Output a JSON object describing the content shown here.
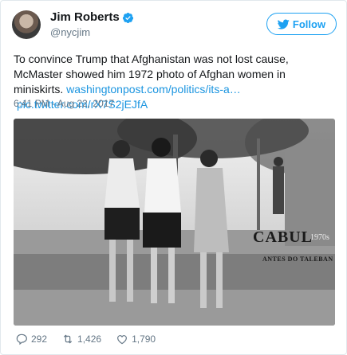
{
  "tweet": {
    "author_name": "Jim Roberts",
    "author_handle": "@nycjim",
    "follow_label": "Follow",
    "text": "To convince Trump that Afghanistan was not lost cause, McMaster showed him 1972 photo of Afghan women in miniskirts.",
    "link_1": "washingtonpost.com/politics/its-a…",
    "link_2": "pic.twitter.com/rX7S2jEJfA",
    "timestamp": "6:41 PM - Aug 22, 2017",
    "replies": "292",
    "retweets": "1,426",
    "likes": "1,790"
  },
  "photo": {
    "title": "CABUL",
    "decade": "1970s",
    "subtitle": "ANTES DO TALEBAN"
  },
  "colors": {
    "accent": "#1da1f2",
    "link": "#1b95e0",
    "muted": "#657786"
  }
}
